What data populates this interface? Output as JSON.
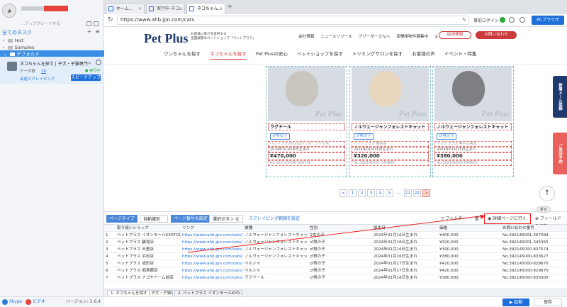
{
  "sidebar": {
    "upgrade_text": "...アップグレードする",
    "all_tasks": "全てのタスク",
    "tree": [
      "test",
      "Samples",
      "デフォルト"
    ],
    "task": {
      "name": "ネコちゃんを探す | 子犬・子猫専門ペットシ...",
      "data_label": "データ数",
      "data_count": "16",
      "status": "実行中",
      "cloud": "高速スクレイピング",
      "speed_button": "スピードアップ"
    },
    "footer": {
      "skype": "Skype",
      "video": "ビデオ",
      "version": "バージョン: 3.6.4"
    }
  },
  "browser": {
    "tabs": [
      "ホーム...",
      "実行中-ネコ...",
      "ネコちゃん..."
    ],
    "url": "https://www.ahb.jpn.com/cats",
    "login": "事前ログイン",
    "pc_browser": "PCブラウザ"
  },
  "site": {
    "logo": "Pet Plus",
    "tagline": [
      "お客様に幸せを提供する",
      "全国展開のペットショップ「ペットプラス」"
    ],
    "top_links": [
      "会社情報",
      "ニュースリリース",
      "ブリーダーさんへ",
      "店舗用物件募集中",
      "よくあるご質問"
    ],
    "recruit": "採用情報",
    "contact": "お問い合わせ",
    "nav": [
      "ワンちゃんを探す",
      "ネコちゃんを探す",
      "Pet Plusの安心",
      "ペットショップを探す",
      "トリミングサロンを探す",
      "お客様の声",
      "イベント・特集"
    ],
    "cards": [
      {
        "name": "ラグドール",
        "sex": "♂男の子",
        "shop": "ペットプラスmozoワンダーシティ店",
        "date": "2024年01月16日生まれ",
        "price": "¥470,000",
        "no": "No.392145000-826736"
      },
      {
        "name": "ノルウェージャンフォレストキャット",
        "sex": "♂男の子",
        "shop": "ペットプラス 横浜店",
        "date": "2024年01月16日生まれ",
        "price": "¥320,000",
        "no": "No.392146001-345968"
      },
      {
        "name": "ノルウェージャンフォレストキャット",
        "sex": "♂男の子",
        "shop": "ペットプラス 神戸三宮店",
        "date": "2024年01月15日生まれ",
        "price": "¥380,000",
        "no": "No.392145000-648623"
      }
    ],
    "watermark": "Pet Plus",
    "pager": [
      "<",
      "1",
      "2",
      "3",
      "4",
      "5",
      "...",
      "21",
      "22",
      ">"
    ],
    "side_buttons": [
      "新着メール登録",
      "ご来店予約"
    ],
    "up": "↑"
  },
  "panel": {
    "page_type": "ページタイプ",
    "auto_detect": "自動識別",
    "page_number": "ページ番号の設定",
    "next_button": "選択ボタン など...",
    "scrape_range": "スクレイピング範囲を設定",
    "filter": "フィルター",
    "goto_detail": "詳細ページに行く",
    "add_field": "フィールドを追加",
    "collapse": "折る",
    "headers": [
      "取り扱いショップ",
      "リンク",
      "猫種",
      "性別",
      "誕生日",
      "価格",
      "お問い合わせ番号"
    ],
    "rows": [
      [
        "1",
        "ペットプラス イオンモールKYOTO店",
        "https://www.ahb.jpn.com/cats/30002...",
        "ノルウェージャンフォレストキャット",
        "♀女の子",
        "2024年01月16日生まれ",
        "¥400,000",
        "No.392146001-367094"
      ],
      [
        "2",
        "ペットプラス 鶴見店",
        "https://www.ahb.jpn.com/cats/30002...",
        "ノルウェージャンフォレストキャット",
        "♂男の子",
        "2024年01月16日生まれ",
        "¥320,000",
        "No.392146001-345355"
      ],
      [
        "3",
        "ペットプラス 天童店",
        "https://www.ahb.jpn.com/cats/70000...",
        "ノルウェージャンフォレストキャット",
        "♂男の子",
        "2024年01月16日生まれ",
        "¥390,000",
        "No.392145000-837574"
      ],
      [
        "4",
        "ペットプラス 浜松店",
        "https://www.ahb.jpn.com/cats/70000...",
        "ノルウェージャンフォレストキャット",
        "♂男の子",
        "2024年01月16日生まれ",
        "¥380,000",
        "No.392145000-833627"
      ],
      [
        "5",
        "ペットプラス 成田店",
        "https://www.ahb.jpn.com/cats/30000...",
        "ペルシャ",
        "♂男の子",
        "2024年01月17日生まれ",
        "¥420,000",
        "No.392145000-829670"
      ],
      [
        "6",
        "ペットプラス 昭島郷店",
        "https://www.ahb.jpn.com/cats/70000...",
        "ペルシャ",
        "♂男の子",
        "2024年01月17日生まれ",
        "¥420,000",
        "No.392145000-829670"
      ],
      [
        "7",
        "ペットプラス ナゴヤドーム前店",
        "https://www.ahb.jpn.com/cats/30000...",
        "ラグドール",
        "♂男の子",
        "2024年01月18日生まれ",
        "¥380,000",
        "No.392145000-835005"
      ]
    ],
    "task_tabs": [
      "1. ネコちゃんを探す | 子犬・子猫専...",
      "2. ペットプラス イオンモールKYO..."
    ],
    "start": "▶ 起動",
    "save": "保存"
  },
  "colors": {
    "accent": "#1e6fd9",
    "brand": "#1f3a6e",
    "highlight": "#e22222"
  }
}
